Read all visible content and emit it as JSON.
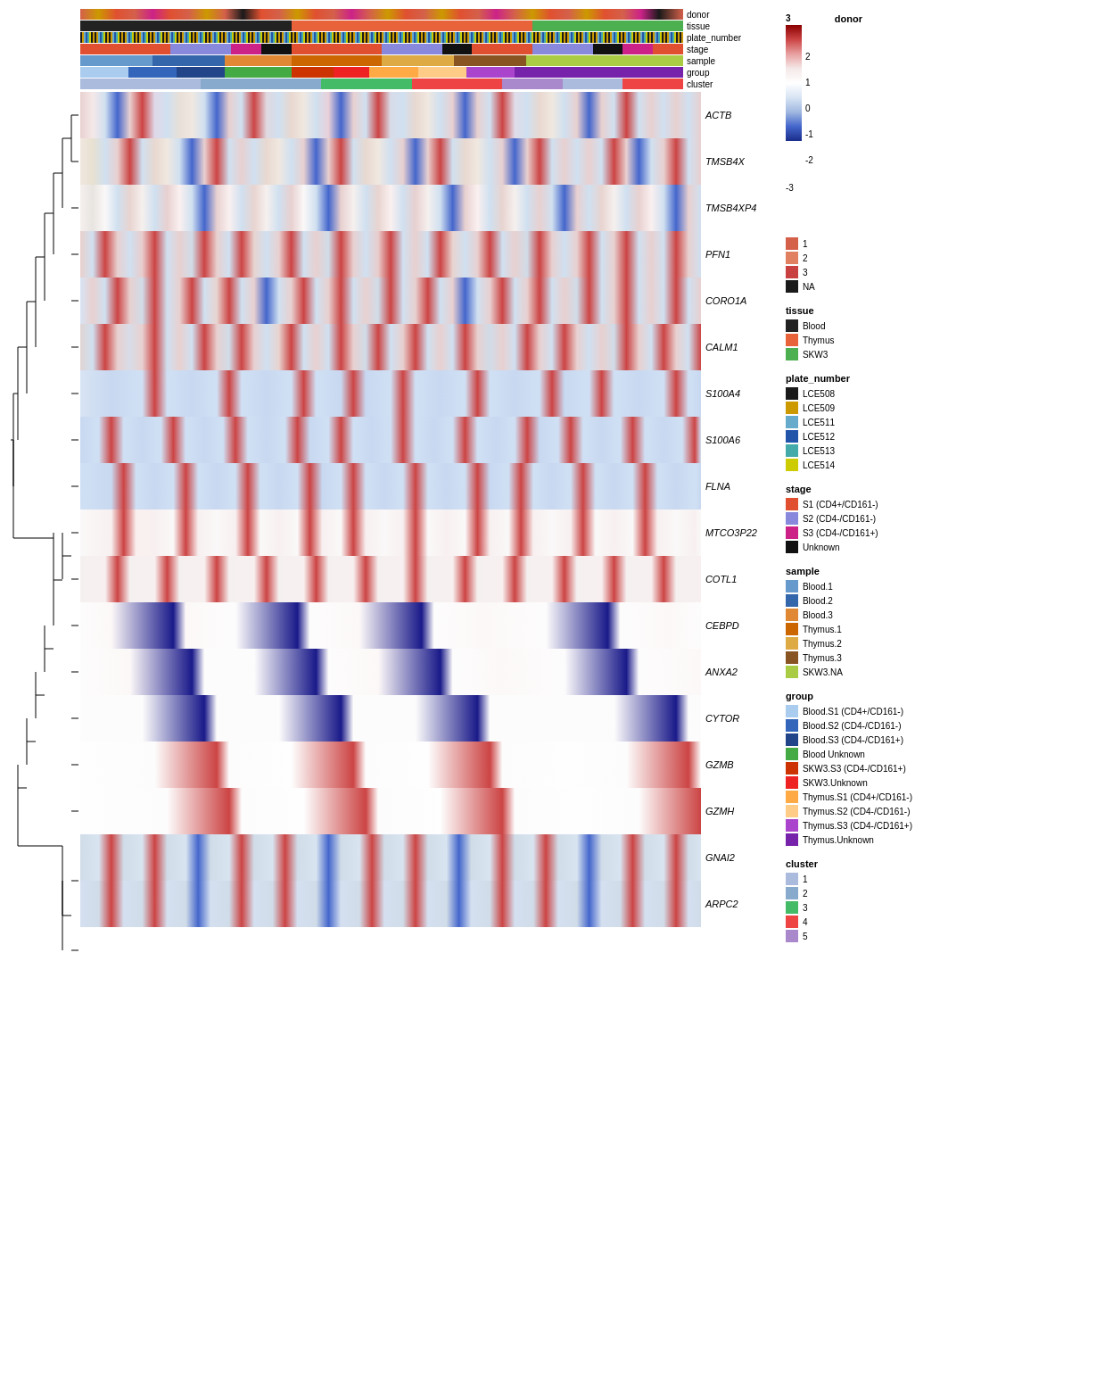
{
  "genes": [
    "ACTB",
    "TMSB4X",
    "TMSB4XP4",
    "PFN1",
    "CORO1A",
    "CALM1",
    "S100A4",
    "S100A6",
    "FLNA",
    "MTCO3P22",
    "COTL1",
    "CEBPD",
    "ANXA2",
    "CYTOR",
    "GZMB",
    "GZMH",
    "GNAI2",
    "ARPC2"
  ],
  "annotation_labels": [
    "donor",
    "tissue",
    "plate_number",
    "stage",
    "sample",
    "group",
    "cluster"
  ],
  "legend": {
    "donor": {
      "title": "donor",
      "scale": true,
      "min": 0,
      "max": 3,
      "ticks": [
        "3",
        "2",
        "1",
        "0",
        "-1",
        "-2",
        "-3"
      ],
      "items": [
        {
          "label": "1",
          "color": "#d4604a"
        },
        {
          "label": "2",
          "color": "#e08060"
        },
        {
          "label": "3",
          "color": "#c84040"
        },
        {
          "label": "NA",
          "color": "#1a1a1a"
        }
      ]
    },
    "tissue": {
      "title": "tissue",
      "items": [
        {
          "label": "Blood",
          "color": "#222222"
        },
        {
          "label": "Thymus",
          "color": "#e8623a"
        },
        {
          "label": "SKW3",
          "color": "#4caf50"
        }
      ]
    },
    "plate_number": {
      "title": "plate_number",
      "items": [
        {
          "label": "LCE508",
          "color": "#1a1a1a"
        },
        {
          "label": "LCE509",
          "color": "#cc9900"
        },
        {
          "label": "LCE511",
          "color": "#66aacc"
        },
        {
          "label": "LCE512",
          "color": "#2255aa"
        },
        {
          "label": "LCE513",
          "color": "#44aaaa"
        },
        {
          "label": "LCE514",
          "color": "#cccc00"
        }
      ]
    },
    "stage": {
      "title": "stage",
      "items": [
        {
          "label": "S1 (CD4+/CD161-)",
          "color": "#e05030"
        },
        {
          "label": "S2 (CD4-/CD161-)",
          "color": "#8888dd"
        },
        {
          "label": "S3 (CD4-/CD161+)",
          "color": "#cc2288"
        },
        {
          "label": "Unknown",
          "color": "#111111"
        }
      ]
    },
    "sample": {
      "title": "sample",
      "items": [
        {
          "label": "Blood.1",
          "color": "#6699cc"
        },
        {
          "label": "Blood.2",
          "color": "#3366aa"
        },
        {
          "label": "Blood.3",
          "color": "#e08833"
        },
        {
          "label": "Thymus.1",
          "color": "#cc6600"
        },
        {
          "label": "Thymus.2",
          "color": "#ddaa44"
        },
        {
          "label": "Thymus.3",
          "color": "#885522"
        },
        {
          "label": "SKW3.NA",
          "color": "#aacc44"
        }
      ]
    },
    "group": {
      "title": "group",
      "items": [
        {
          "label": "Blood.S1 (CD4+/CD161-)",
          "color": "#aaccee"
        },
        {
          "label": "Blood.S2 (CD4-/CD161-)",
          "color": "#3366bb"
        },
        {
          "label": "Blood.S3 (CD4-/CD161+)",
          "color": "#224488"
        },
        {
          "label": "Blood.Unknown",
          "color": "#44aa44"
        },
        {
          "label": "SKW3.S3 (CD4-/CD161+)",
          "color": "#cc3300"
        },
        {
          "label": "SKW3.Unknown",
          "color": "#ee2222"
        },
        {
          "label": "Thymus.S1 (CD4+/CD161-)",
          "color": "#ffaa44"
        },
        {
          "label": "Thymus.S2 (CD4-/CD161-)",
          "color": "#ffcc88"
        },
        {
          "label": "Thymus.S3 (CD4-/CD161+)",
          "color": "#aa44cc"
        },
        {
          "label": "Thymus.Unknown",
          "color": "#7722aa"
        }
      ]
    },
    "cluster": {
      "title": "cluster",
      "items": [
        {
          "label": "1",
          "color": "#aabbdd"
        },
        {
          "label": "2",
          "color": "#88aacc"
        },
        {
          "label": "3",
          "color": "#44bb66"
        },
        {
          "label": "4",
          "color": "#ee4444"
        },
        {
          "label": "5",
          "color": "#aa88cc"
        }
      ]
    }
  },
  "detected_texts": {
    "blood_unknown": "Blood Unknown",
    "thymus": "Thymus",
    "unknown": "Unknown"
  }
}
